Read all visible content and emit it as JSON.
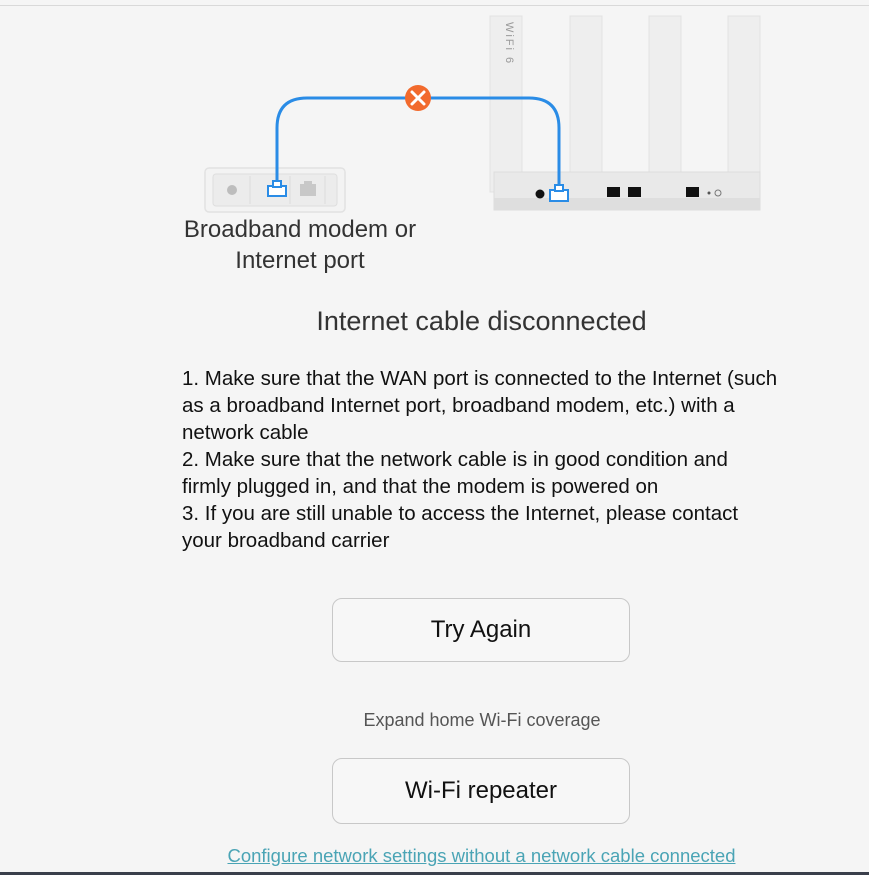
{
  "diagram": {
    "modem_label_line1": "Broadband modem or",
    "modem_label_line2": "Internet port",
    "router_brand_text": "WiFi 6",
    "cable_color": "#2a8ce6",
    "error_marker_color": "#f26a2d",
    "disconnect_icon": "x-icon"
  },
  "status": {
    "title": "Internet cable disconnected"
  },
  "instructions": [
    "1. Make sure that the WAN port is connected to the Internet (such as a broadband Internet port, broadband modem, etc.) with a network cable",
    "2. Make sure that the network cable is in good condition and firmly plugged in, and that the modem is powered on",
    "3. If you are still unable to access the Internet, please contact your broadband carrier"
  ],
  "buttons": {
    "try_again": "Try Again",
    "wifi_repeater": "Wi-Fi repeater"
  },
  "expand_label": "Expand home Wi-Fi coverage",
  "configure_link": "Configure network settings without a network cable connected"
}
